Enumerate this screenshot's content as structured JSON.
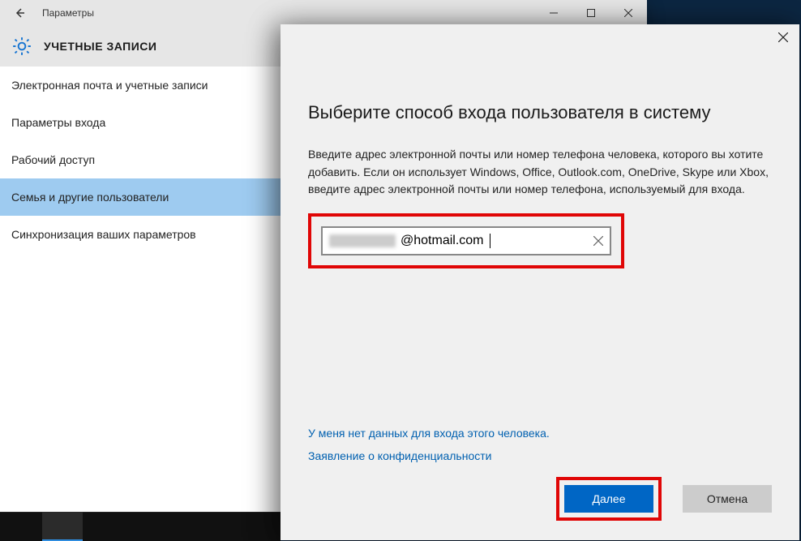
{
  "settings": {
    "window_title": "Параметры",
    "heading": "УЧЕТНЫЕ ЗАПИСИ",
    "sidebar": [
      {
        "label": "Электронная почта и учетные записи",
        "active": false
      },
      {
        "label": "Параметры входа",
        "active": false
      },
      {
        "label": "Рабочий доступ",
        "active": false
      },
      {
        "label": "Семья и другие пользователи",
        "active": true
      },
      {
        "label": "Синхронизация ваших параметров",
        "active": false
      }
    ]
  },
  "dialog": {
    "title": "Выберите способ входа пользователя в систему",
    "description": "Введите адрес электронной почты или номер телефона человека, которого вы хотите добавить. Если он использует Windows, Office, Outlook.com, OneDrive, Skype или Xbox, введите адрес электронной почты или номер телефона, используемый для входа.",
    "email_value": "@hotmail.com",
    "link_no_data": "У меня нет данных для входа этого человека.",
    "link_privacy": "Заявление о конфиденциальности",
    "btn_next": "Далее",
    "btn_cancel": "Отмена"
  }
}
